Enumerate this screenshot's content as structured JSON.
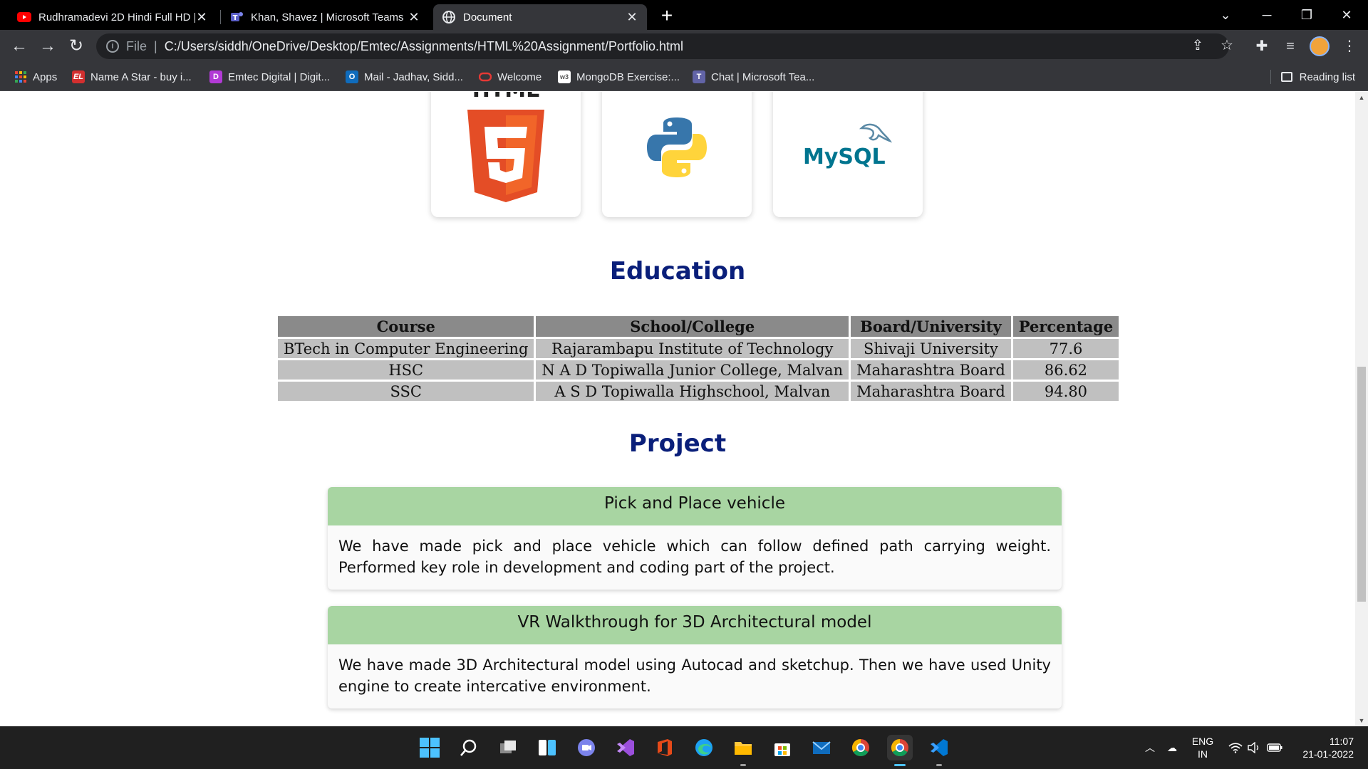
{
  "browser": {
    "tabs": [
      {
        "title": "Rudhramadevi 2D Hindi Full HD |",
        "favicon": "youtube-icon",
        "active": false
      },
      {
        "title": "Khan, Shavez | Microsoft Teams",
        "favicon": "teams-icon",
        "active": false
      },
      {
        "title": "Document",
        "favicon": "globe-icon",
        "active": true
      }
    ],
    "address": {
      "scheme_label": "File",
      "url": "C:/Users/siddh/OneDrive/Desktop/Emtec/Assignments/HTML%20Assignment/Portfolio.html"
    },
    "bookmarks": [
      {
        "label": "Apps",
        "icon": "apps-grid-icon",
        "color": "#4285f4"
      },
      {
        "label": "Name A Star - buy i...",
        "icon": "el-icon",
        "color": "#d32f2f",
        "badge": "EL"
      },
      {
        "label": "Emtec Digital | Digit...",
        "icon": "emtec-icon",
        "color": "#b23ad6"
      },
      {
        "label": "Mail - Jadhav, Sidd...",
        "icon": "outlook-icon",
        "color": "#0f6cbd"
      },
      {
        "label": "Welcome",
        "icon": "oracle-icon",
        "color": "#e53935"
      },
      {
        "label": "MongoDB Exercise:...",
        "icon": "w3-icon",
        "color": "#ffffff",
        "badge": "w3"
      },
      {
        "label": "Chat | Microsoft Tea...",
        "icon": "teams-icon",
        "color": "#6264a7"
      }
    ],
    "reading_list": "Reading list"
  },
  "page": {
    "skills": [
      {
        "name": "html5-logo",
        "label": "HTML"
      },
      {
        "name": "python-logo"
      },
      {
        "name": "mysql-logo",
        "label": "MySQL"
      }
    ],
    "education": {
      "heading": "Education",
      "columns": [
        "Course",
        "School/College",
        "Board/University",
        "Percentage"
      ],
      "rows": [
        [
          "BTech in Computer Engineering",
          "Rajarambapu Institute of Technology",
          "Shivaji University",
          "77.6"
        ],
        [
          "HSC",
          "N A D Topiwalla Junior College, Malvan",
          "Maharashtra Board",
          "86.62"
        ],
        [
          "SSC",
          "A S D Topiwalla Highschool, Malvan",
          "Maharashtra Board",
          "94.80"
        ]
      ]
    },
    "project": {
      "heading": "Project",
      "items": [
        {
          "title": "Pick and Place vehicle",
          "description": "We have made pick and place vehicle which can follow defined path carrying weight. Performed key role in development and coding part of the project."
        },
        {
          "title": "VR Walkthrough for 3D Architectural model",
          "description": "We have made 3D Architectural model using Autocad and sketchup. Then we have used Unity engine to create intercative environment."
        }
      ]
    }
  },
  "taskbar": {
    "language": {
      "line1": "ENG",
      "line2": "IN"
    },
    "time": "11:07",
    "date": "21-01-2022"
  },
  "colors": {
    "heading": "#0a1f7a",
    "project_header": "#a8d5a2",
    "table_header": "#8a8a8a",
    "table_cell": "#c0c0c0"
  }
}
